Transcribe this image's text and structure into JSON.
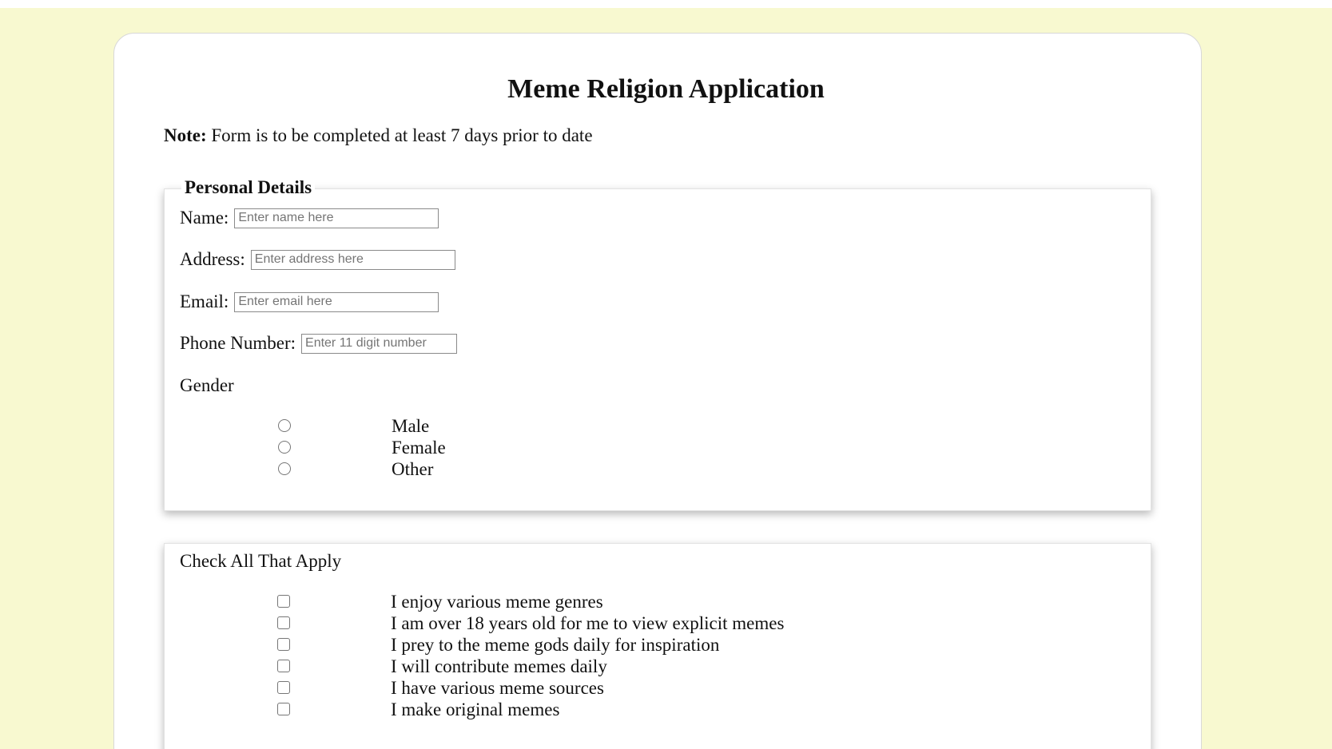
{
  "title": "Meme Religion Application",
  "note": {
    "label": "Note:",
    "text": " Form is to be completed at least 7 days prior to date"
  },
  "personal": {
    "legend": "Personal Details",
    "name_label": "Name:",
    "name_placeholder": "Enter name here",
    "address_label": "Address:",
    "address_placeholder": "Enter address here",
    "email_label": "Email:",
    "email_placeholder": "Enter email here",
    "phone_label": "Phone Number:",
    "phone_placeholder": "Enter 11 digit number",
    "gender_label": "Gender",
    "gender_options": [
      "Male",
      "Female",
      "Other"
    ]
  },
  "checks": {
    "heading": "Check All That Apply",
    "options": [
      "I enjoy various meme genres",
      "I am over 18 years old for me to view explicit memes",
      "I prey to the meme gods daily for inspiration",
      "I will contribute memes daily",
      "I have various meme sources",
      "I make original memes"
    ]
  },
  "colors": {
    "page_background": "#f8f9d0",
    "card_background": "#ffffff"
  }
}
